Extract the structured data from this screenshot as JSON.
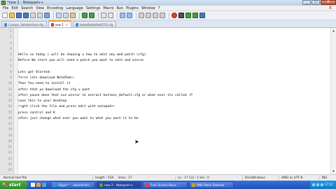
{
  "window": {
    "title": "*new 2 - Notepad++",
    "min_label": "_",
    "max_label": "□",
    "close_label": "X"
  },
  "menu": {
    "items": [
      "File",
      "Edit",
      "Search",
      "View",
      "Encoding",
      "Language",
      "Settings",
      "Macro",
      "Run",
      "Plugins",
      "Window",
      "?"
    ],
    "close_label": "X"
  },
  "tabs": [
    {
      "label": "Custom_ValidateUser.cfg",
      "active": false
    },
    {
      "label": "new 2",
      "active": true
    },
    {
      "label": "botesBattlefieldCFG.cfg",
      "active": false
    }
  ],
  "editor": {
    "line_numbers": [
      "1",
      "2",
      "3",
      "4",
      "5",
      "6",
      "7",
      "8",
      "9",
      "10",
      "11",
      "12",
      "13",
      "14",
      "15",
      "16",
      "17",
      "18",
      "19",
      "20",
      "21",
      "22",
      "23",
      "24",
      "25"
    ],
    "lines": [
      "",
      "",
      "",
      "",
      "Hello so today i will be showing u how to edit any mod patch (cfg)",
      "Before We start you will need a patch you want to edit and winrar",
      "",
      "Lets get Started:",
      "first lets download NotePad++",
      "Then You need to install it",
      "after that yo download the cfg u want",
      "after youve done that use winrar to extract buttons_default.cfg or what ever its called :P",
      "save this to your desktop",
      "right click the file and press edit with notepad++",
      "press control and H",
      "after just change what ever you want to what you want it to be",
      "",
      "",
      "",
      "",
      "",
      "",
      "",
      "",
      ""
    ]
  },
  "status": {
    "file_type": "Normal text file",
    "length": "length : 519",
    "lines": "lines : 17",
    "position": "Ln : 17    Col : 1    Sel : 0",
    "eol": "Dos\\Windows",
    "encoding": "ANSI as UTF-8",
    "mode": "INS"
  },
  "taskbar": {
    "start_label": "start",
    "tasks": [
      {
        "label": "Skype™ - adamfisher...",
        "active": false
      },
      {
        "label": "new 2 - Notepad++",
        "active": true
      },
      {
        "label": "Free Screen Reco...",
        "active": false
      },
      {
        "label": "BNS Patch Selector",
        "active": false
      }
    ],
    "clock": "17:21"
  },
  "colors": {
    "accent": "#f0a030",
    "taskbar": "#2151b8",
    "start": "#2f8a2a"
  }
}
